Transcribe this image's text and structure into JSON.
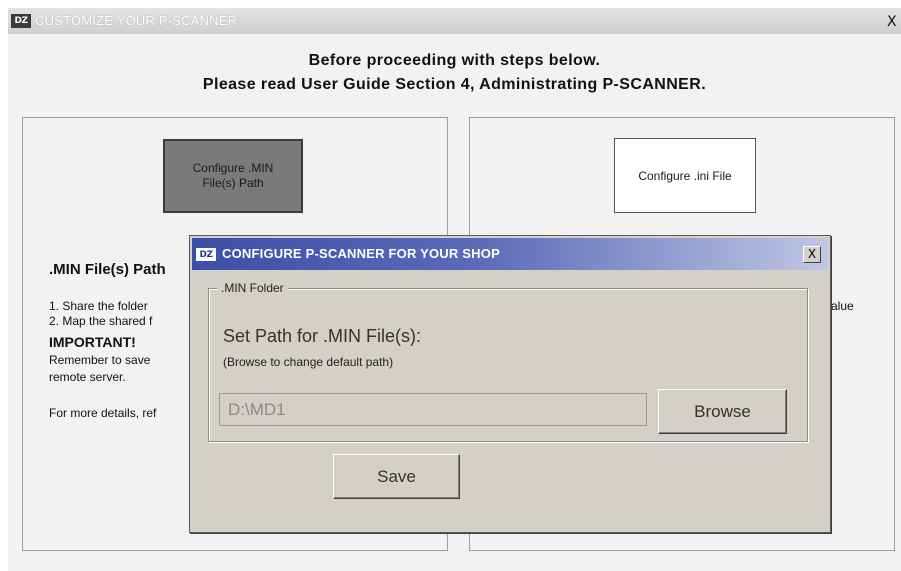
{
  "main_window": {
    "logo": "DZ",
    "title": "CUSTOMIZE YOUR P-SCANNER",
    "close_glyph": "X",
    "header_line1": "Before proceeding with steps below.",
    "header_line2": "Please read User Guide Section 4, Administrating P-SCANNER."
  },
  "left_panel": {
    "button_line1": "Configure .MIN",
    "button_line2": "File(s) Path",
    "heading": ".MIN File(s) Path",
    "step1": "1. Share the folder",
    "step2": "2. Map the shared f",
    "important": "IMPORTANT!",
    "remember1": "Remember to save",
    "remember2": "remote server.",
    "more": "For more details, ref"
  },
  "right_panel": {
    "button_label": "Configure .ini File",
    "partial_text": "alue"
  },
  "dialog": {
    "logo": "DZ",
    "title": "CONFIGURE P-SCANNER FOR YOUR SHOP",
    "close_glyph": "X",
    "legend": ".MIN Folder",
    "set_path_label": "Set Path for .MIN File(s):",
    "browse_hint": "(Browse to change default path)",
    "path_value": "D:\\MD1",
    "browse_label": "Browse",
    "save_label": "Save"
  },
  "colors": {
    "dialog_titlebar": "#3b4fa8",
    "dialog_face": "#d4d0c8",
    "dark_button": "#7a7a7a"
  }
}
